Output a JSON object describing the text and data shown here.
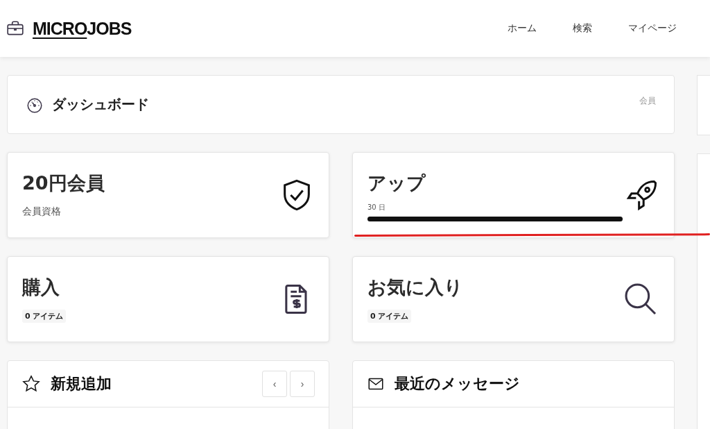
{
  "header": {
    "logo_underlined": "MICRO",
    "logo_rest": "JOBS",
    "nav": [
      "ホーム",
      "検索",
      "マイページ"
    ]
  },
  "dashboard": {
    "title": "ダッシュボード",
    "badge": "会員"
  },
  "cards": [
    {
      "kind": "membership",
      "title": "20円会員",
      "subtitle": "会員資格"
    },
    {
      "kind": "upgrade",
      "title": "アップ",
      "caption": "30 日",
      "level": 1
    },
    {
      "kind": "purchases",
      "title": "購入",
      "count": "0 アイテム"
    },
    {
      "kind": "favorites",
      "title": "お気に入り",
      "count": "0 アイテム"
    }
  ],
  "panels": [
    {
      "kind": "new",
      "title": "新規追加",
      "prev": "‹",
      "next": "›"
    },
    {
      "kind": "messages",
      "title": "最近のメッセージ"
    }
  ]
}
